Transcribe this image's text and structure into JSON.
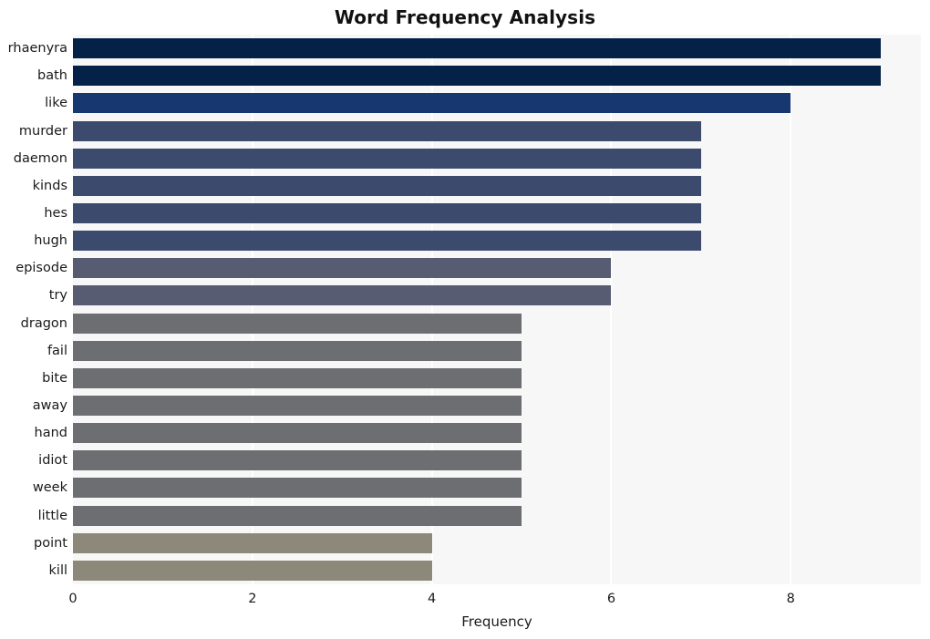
{
  "chart_data": {
    "type": "bar",
    "orientation": "horizontal",
    "title": "Word Frequency Analysis",
    "xlabel": "Frequency",
    "ylabel": "",
    "categories": [
      "rhaenyra",
      "bath",
      "like",
      "murder",
      "daemon",
      "kinds",
      "hes",
      "hugh",
      "episode",
      "try",
      "dragon",
      "fail",
      "bite",
      "away",
      "hand",
      "idiot",
      "week",
      "little",
      "point",
      "kill"
    ],
    "values": [
      9,
      9,
      8,
      7,
      7,
      7,
      7,
      7,
      6,
      6,
      5,
      5,
      5,
      5,
      5,
      5,
      5,
      5,
      4,
      4
    ],
    "bar_colors": [
      "#042147",
      "#042147",
      "#16376f",
      "#3c4a6e",
      "#3c4a6e",
      "#3c4a6e",
      "#3c4a6e",
      "#3c4a6e",
      "#575c73",
      "#575c73",
      "#6d6e71",
      "#6d6e71",
      "#6d6e71",
      "#6d6e71",
      "#6d6e71",
      "#6d6e71",
      "#6d6e71",
      "#6d6e71",
      "#8d897a",
      "#8d897a"
    ],
    "xlim": [
      0,
      9.45
    ],
    "x_ticks": [
      0,
      2,
      4,
      6,
      8
    ],
    "x_tick_labels": [
      "0",
      "2",
      "4",
      "6",
      "8"
    ],
    "grid": "vertical-white",
    "plot_background": "#f7f7f7",
    "figure_background": "#ffffff",
    "legend": null
  }
}
